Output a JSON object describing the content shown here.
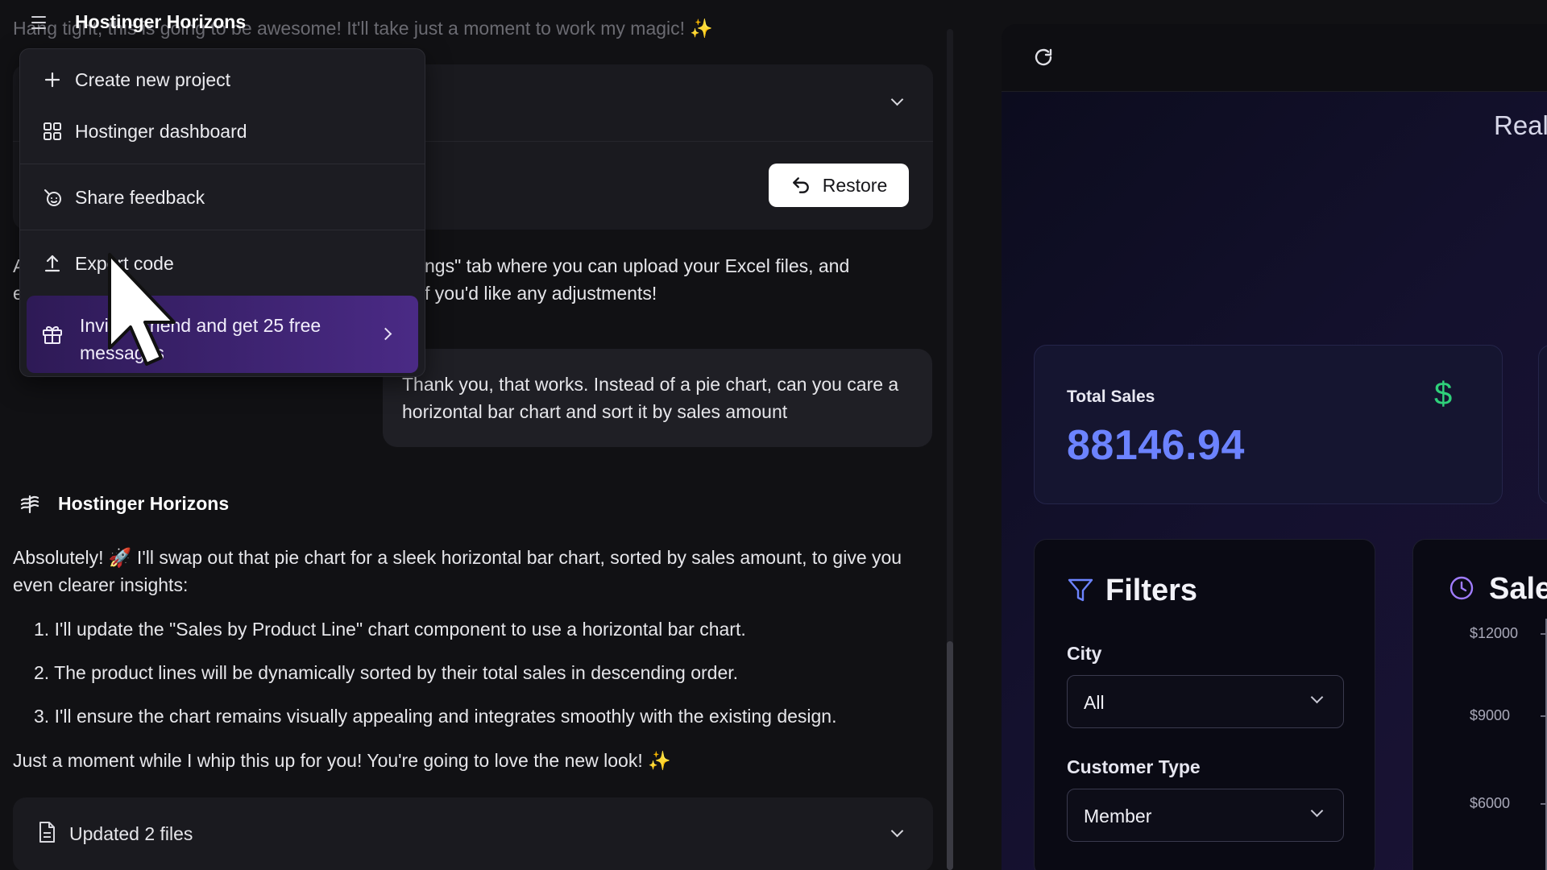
{
  "chat": {
    "app_title": "Hostinger Horizons",
    "faded_message": "Hang tight, this is going to be awesome! It'll take just a moment to work my magic! ✨",
    "restore_label": "Restore",
    "partial_line1": "A",
    "partial_line1b": "ngs\" tab where you can upload your Excel files, and",
    "partial_line2": "e",
    "partial_line2b": "f you'd like any adjustments!",
    "user_message": "Thank you, that works. Instead of a pie chart, can you care a horizontal bar chart and sort it by sales amount",
    "bot_name": "Hostinger Horizons",
    "reply_intro": "Absolutely! 🚀 I'll swap out that pie chart for a sleek horizontal bar chart, sorted by sales amount, to give you even clearer insights:",
    "reply_items": [
      "1. I'll update the \"Sales by Product Line\" chart component to use a horizontal bar chart.",
      "2. The product lines will be dynamically sorted by their total sales in descending order.",
      "3. I'll ensure the chart remains visually appealing and integrates smoothly with the existing design."
    ],
    "reply_outro": "Just a moment while I whip this up for you! You're going to love the new look! ✨",
    "files_label": "Updated 2 files"
  },
  "menu": {
    "items": [
      {
        "label": "Create new project",
        "icon": "plus-icon"
      },
      {
        "label": "Hostinger dashboard",
        "icon": "dashboard-grid-icon"
      },
      {
        "label": "Share feedback",
        "icon": "feedback-icon"
      },
      {
        "label": "Export code",
        "icon": "upload-icon"
      }
    ],
    "invite_label": "Invite a friend and get 25 free messages",
    "invite_icon": "gift-icon"
  },
  "preview": {
    "title_partial": "Real-",
    "total_sales_label": "Total Sales",
    "total_sales_value": "88146.94",
    "filters_title": "Filters",
    "city_label": "City",
    "city_value": "All",
    "customer_type_label": "Customer Type",
    "customer_type_value": "Member",
    "sales_title": "Sales",
    "y_ticks": [
      "$12000",
      "$9000",
      "$6000"
    ],
    "accent_color": "#6c83ff",
    "dollar_color": "#2fd07a"
  }
}
